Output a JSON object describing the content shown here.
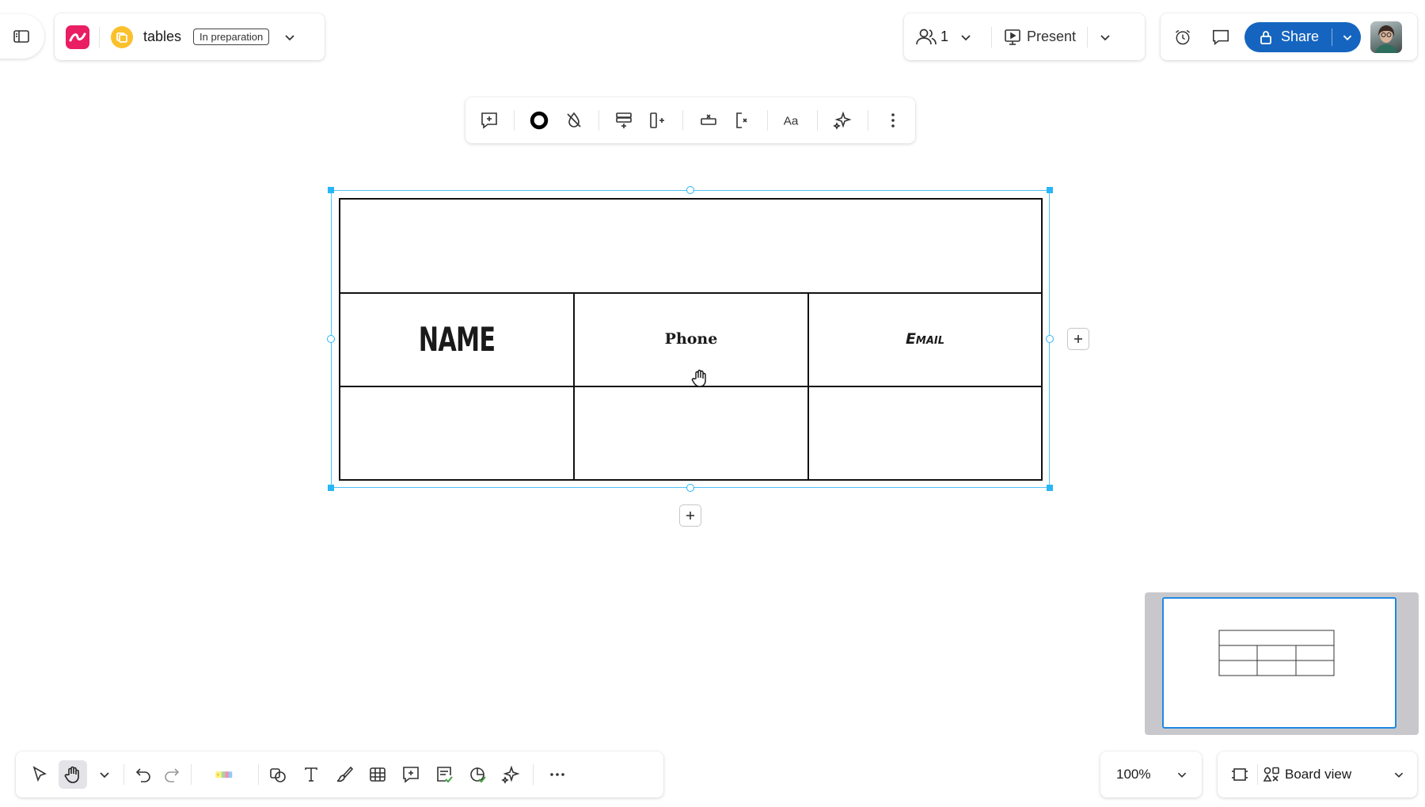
{
  "board": {
    "name": "tables",
    "status": "In preparation"
  },
  "collaboration": {
    "user_count": "1",
    "present_label": "Present",
    "share_label": "Share"
  },
  "table": {
    "headers": [
      "NAME",
      "Phone",
      "Email"
    ]
  },
  "zoom": {
    "level": "100%"
  },
  "view": {
    "label": "Board view"
  },
  "colors": {
    "accent": "#1565c0",
    "selection": "#4fc3f7",
    "logo": "#e91e63",
    "board_icon": "#fbc02d"
  },
  "icons": {
    "top_left": [
      "sidebar-toggle-icon",
      "app-logo-icon",
      "board-icon",
      "chevron-down-icon"
    ],
    "top_right": [
      "users-icon",
      "chevron-down-icon",
      "present-icon",
      "chevron-down-icon",
      "timer-icon",
      "comment-icon",
      "lock-icon",
      "chevron-down-icon",
      "avatar"
    ],
    "context_toolbar": [
      "add-comment-icon",
      "border-style-icon",
      "no-fill-icon",
      "insert-row-icon",
      "insert-column-icon",
      "delete-row-icon",
      "delete-column-icon",
      "text-format-icon",
      "ai-sparkle-icon",
      "more-options-icon"
    ],
    "bottom_toolbar": [
      "select-icon",
      "hand-icon",
      "chevron-down-icon",
      "undo-icon",
      "redo-icon",
      "sticky-notes-icon",
      "shapes-icon",
      "text-icon",
      "pen-icon",
      "table-icon",
      "comment-icon",
      "card-icon",
      "sticker-icon",
      "ai-sparkle-icon",
      "more-icon"
    ],
    "view_panel": [
      "frame-icon",
      "board-view-icon",
      "chevron-down-icon"
    ]
  }
}
